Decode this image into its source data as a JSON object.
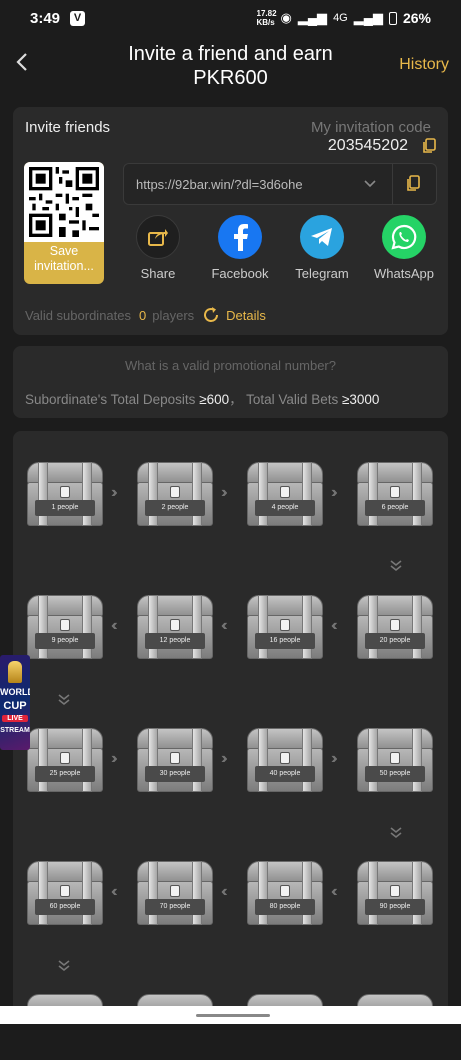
{
  "status": {
    "time": "3:49",
    "v_badge": "V",
    "net_speed": "17.82 KB/s",
    "network": "4G",
    "battery": "26%"
  },
  "header": {
    "title_line1": "Invite a friend and earn",
    "title_line2": "PKR600",
    "history_label": "History"
  },
  "invite": {
    "label": "Invite friends",
    "code_label": "My invitation code",
    "code_value": "203545202",
    "save_label_line1": "Save",
    "save_label_line2": "invitation...",
    "link": "https://92bar.win/?dl=3d6ohe",
    "share_items": [
      {
        "label": "Share",
        "icon": "share-icon"
      },
      {
        "label": "Facebook",
        "icon": "facebook-icon",
        "color": "#1877f2"
      },
      {
        "label": "Telegram",
        "icon": "telegram-icon",
        "color": "#2aa3df"
      },
      {
        "label": "WhatsApp",
        "icon": "whatsapp-icon",
        "color": "#25d366"
      }
    ],
    "valid_label": "Valid subordinates",
    "valid_count": "0",
    "players_label": "players",
    "details_label": "Details"
  },
  "rules": {
    "question": "What is a valid promotional number?",
    "deposits_label": "Subordinate's Total Deposits",
    "deposits_value": "≥600",
    "separator": "，",
    "bets_label": "Total Valid Bets",
    "bets_value": "≥3000"
  },
  "chests": [
    "1 people",
    "2 people",
    "4 people",
    "6 people",
    "20 people",
    "16 people",
    "12 people",
    "9 people",
    "25 people",
    "30 people",
    "40 people",
    "50 people",
    "90 people",
    "80 people",
    "70 people",
    "60 people"
  ],
  "promo": {
    "line1": "WORLD",
    "line2": "CUP",
    "line3": "LIVE",
    "line4": "STREAM"
  },
  "colors": {
    "accent": "#e8b84a",
    "background": "#1c1c1c",
    "panel": "#2a2a2a"
  }
}
